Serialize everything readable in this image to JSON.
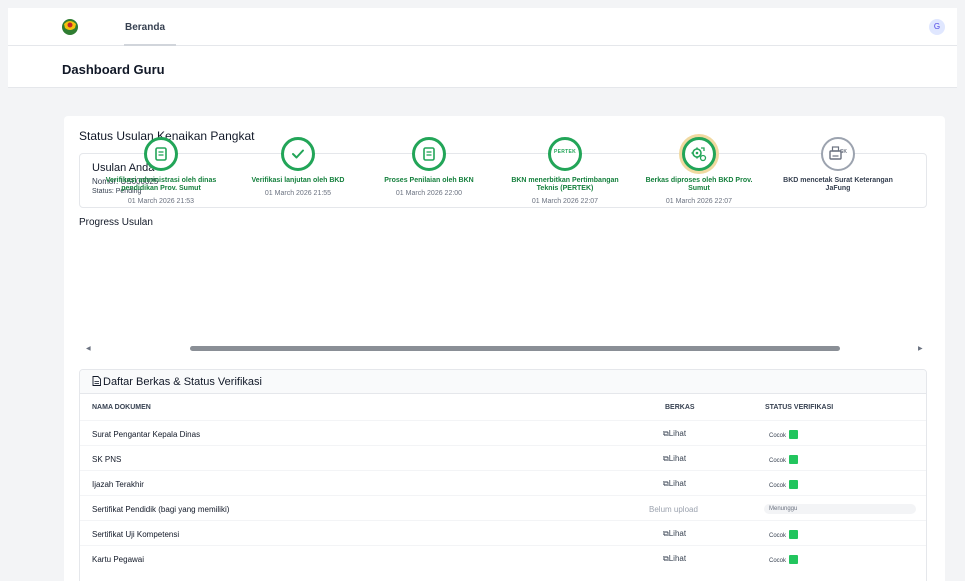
{
  "nav": {
    "tab": "Beranda",
    "avatar": "G"
  },
  "page": {
    "title": "Dashboard Guru"
  },
  "card": {
    "title": "Status Usulan Kenaikan Pangkat"
  },
  "usulan": {
    "title": "Usulan Anda",
    "nomor": "Nomor: US000025",
    "status": "Status:  Pending"
  },
  "progress": {
    "title": "Progress Usulan",
    "steps": [
      {
        "label": "Verifikasi administrasi oleh dinas pendidikan Prov. Sumut",
        "date": "01 March 2026 21:53",
        "icon": "document-icon",
        "done": true
      },
      {
        "label": "Verifikasi lanjutan oleh BKD",
        "date": "01 March 2026 21:55",
        "icon": "check-icon",
        "done": true
      },
      {
        "label": "Proses Penilaian oleh BKN",
        "date": "01 March 2026 22:00",
        "icon": "document-icon",
        "done": true
      },
      {
        "label": "BKN menerbitkan Pertimbangan Teknis (PERTEK)",
        "date": "01 March 2026 22:07",
        "icon": "pertek-stamp-icon",
        "icon_text": "PERTEK",
        "done": true
      },
      {
        "label": "Berkas diproses oleh BKD Prov. Sumut",
        "date": "01 March 2026 22:07",
        "icon": "gear-process-icon",
        "done": true,
        "current": true
      },
      {
        "label": "BKD mencetak Surat Keterangan JaFung",
        "date": "",
        "icon": "printer-icon",
        "icon_text": "SK",
        "done": false
      }
    ]
  },
  "berkas": {
    "title": "Daftar Berkas & Status Verifikasi",
    "columns": {
      "name": "NAMA DOKUMEN",
      "file": "BERKAS",
      "status": "STATUS VERIFIKASI"
    },
    "rows": [
      {
        "name": "Surat Pengantar Kepala Dinas",
        "file": "Lihat",
        "status": "Cocok"
      },
      {
        "name": "SK PNS",
        "file": "Lihat",
        "status": "Cocok"
      },
      {
        "name": "Ijazah Terakhir",
        "file": "Lihat",
        "status": "Cocok"
      },
      {
        "name": "Sertifikat Pendidik (bagi yang memiliki)",
        "file": "Belum upload",
        "status": "Menunggu"
      },
      {
        "name": "Sertifikat Uji Kompetensi",
        "file": "Lihat",
        "status": "Cocok"
      },
      {
        "name": "Kartu Pegawai",
        "file": "Lihat",
        "status": "Cocok"
      }
    ]
  },
  "colors": {
    "accent": "#22a558",
    "check": "#22c55e",
    "glow": "#f0d9a0"
  }
}
